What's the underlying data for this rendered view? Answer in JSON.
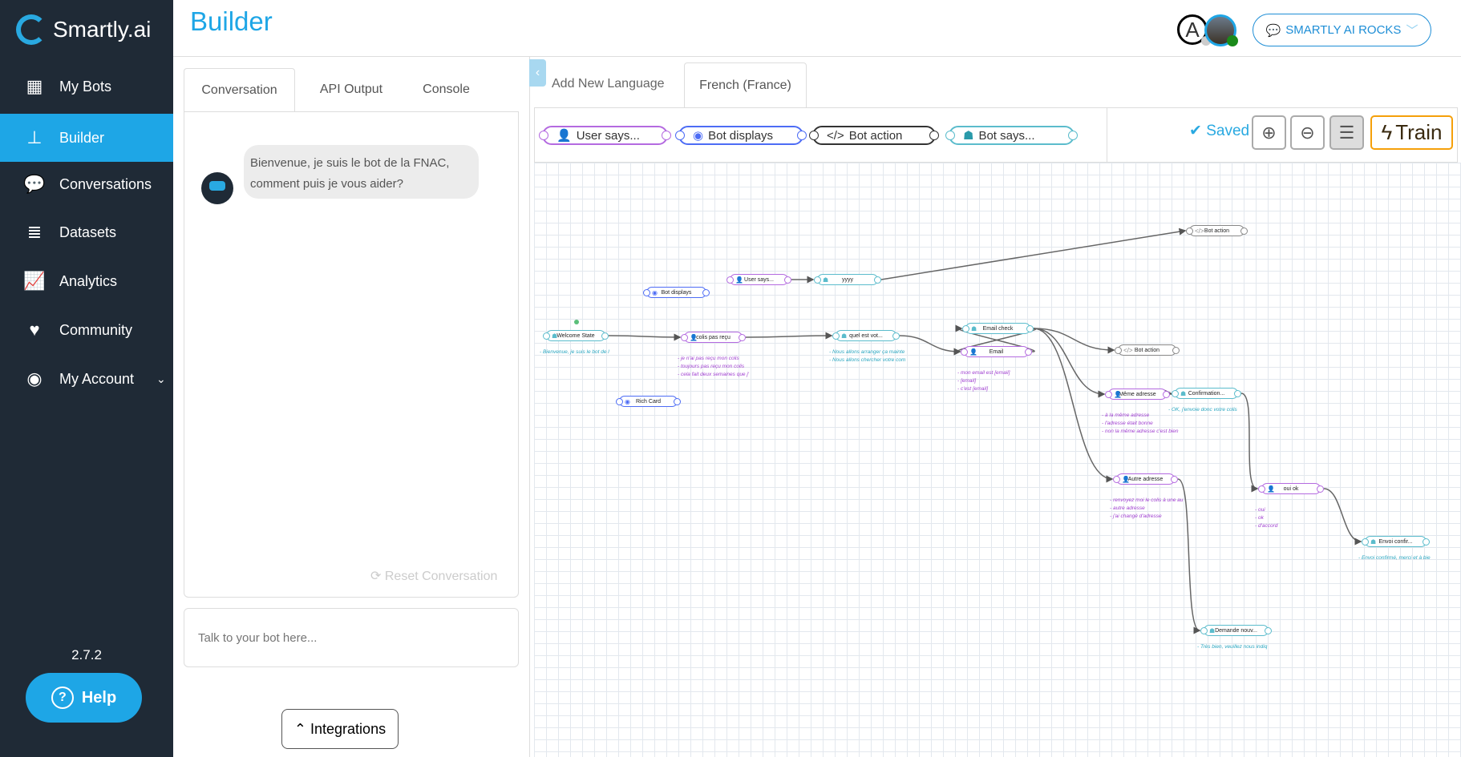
{
  "sidebar": {
    "brand": "Smartly.ai",
    "items": [
      {
        "label": "My Bots",
        "icon": "grid-icon"
      },
      {
        "label": "Builder",
        "icon": "sitemap-icon"
      },
      {
        "label": "Conversations",
        "icon": "chat-icon"
      },
      {
        "label": "Datasets",
        "icon": "database-icon"
      },
      {
        "label": "Analytics",
        "icon": "chart-icon"
      },
      {
        "label": "Community",
        "icon": "heart-icon"
      },
      {
        "label": "My Account",
        "icon": "user-circle-icon"
      }
    ],
    "version": "2.7.2",
    "help": "Help"
  },
  "header": {
    "title": "Builder",
    "avatar_letter": "A",
    "bot_selector": "SMARTLY AI ROCKS"
  },
  "left": {
    "tabs": [
      "Conversation",
      "API Output",
      "Console"
    ],
    "bot_message": "Bienvenue, je suis le bot de la FNAC, comment puis je vous aider?",
    "reset": "Reset Conversation",
    "input_placeholder": "Talk to your bot here...",
    "integrations": "Integrations"
  },
  "lang": {
    "add": "Add New Language",
    "active": "French (France)"
  },
  "toolbar": {
    "chips": [
      "User says...",
      "Bot displays",
      "Bot action",
      "Bot says..."
    ],
    "saved": "Saved",
    "train": "Train"
  },
  "colors": {
    "user": "#b46ae0",
    "bot_says": "#5bbccc",
    "bot_displays": "#4d6cf5",
    "bot_action": "#888888",
    "accent": "#1ea6e6"
  },
  "graph": {
    "nodes": [
      {
        "id": "n1",
        "type": "action",
        "label": "Bot action",
        "utterances": []
      },
      {
        "id": "n2",
        "type": "user",
        "label": "User says...",
        "utterances": []
      },
      {
        "id": "n3",
        "type": "says",
        "label": "yyyy",
        "utterances": []
      },
      {
        "id": "n4",
        "type": "displays",
        "label": "Bot displays",
        "utterances": []
      },
      {
        "id": "n5",
        "type": "says",
        "label": "Welcome State",
        "utterances": [
          "- Bienvenue, je suis le bot de l"
        ]
      },
      {
        "id": "n6",
        "type": "user",
        "label": "colis pas reçu",
        "utterances": [
          "- je n'ai pas reçu mon colis",
          "- toujours pas reçu mon colis",
          "- cela fait deux semaines que j'"
        ]
      },
      {
        "id": "n7",
        "type": "says",
        "label": "quel est vot...",
        "utterances": [
          "- Nous allons arranger ça mainte",
          "- Nous allons chercher votre com"
        ]
      },
      {
        "id": "n8",
        "type": "says",
        "label": "Email check",
        "utterances": []
      },
      {
        "id": "n9",
        "type": "user",
        "label": "Email",
        "utterances": [
          "- mon email est [email]",
          "- [email]",
          "- c'est [email]"
        ]
      },
      {
        "id": "n10",
        "type": "action",
        "label": "Bot action",
        "utterances": []
      },
      {
        "id": "n11",
        "type": "user",
        "label": "Même adresse",
        "utterances": [
          "- à la même adresse",
          "- l'adresse était bonne",
          "- non la même adresse c'est bien"
        ]
      },
      {
        "id": "n12",
        "type": "says",
        "label": "Confirmation...",
        "utterances": [
          "- OK, j'envoie donc votre colis"
        ]
      },
      {
        "id": "n13",
        "type": "user",
        "label": "Autre adresse",
        "utterances": [
          "- renvoyez moi le colis à une au",
          "- autre adresse",
          "- j'ai changé d'adresse"
        ]
      },
      {
        "id": "n14",
        "type": "user",
        "label": "oui ok",
        "utterances": [
          "- oui",
          "- ok",
          "- d'accord"
        ]
      },
      {
        "id": "n15",
        "type": "says",
        "label": "Envoi confir...",
        "utterances": [
          "- Envoi confirmé, merci et à bie"
        ]
      },
      {
        "id": "n16",
        "type": "says",
        "label": "Demande nouv...",
        "utterances": [
          "- Très bien, veuillez nous indiq"
        ]
      },
      {
        "id": "n17",
        "type": "displays",
        "label": "Rich Card",
        "utterances": []
      }
    ],
    "edges": [
      [
        "n3",
        "n1"
      ],
      [
        "n2",
        "n3"
      ],
      [
        "n5",
        "n6"
      ],
      [
        "n6",
        "n7"
      ],
      [
        "n7",
        "n9"
      ],
      [
        "n9",
        "n8"
      ],
      [
        "n8",
        "n9"
      ],
      [
        "n8",
        "n10"
      ],
      [
        "n8",
        "n11"
      ],
      [
        "n8",
        "n13"
      ],
      [
        "n11",
        "n12"
      ],
      [
        "n12",
        "n14"
      ],
      [
        "n13",
        "n16"
      ],
      [
        "n14",
        "n15"
      ]
    ]
  }
}
